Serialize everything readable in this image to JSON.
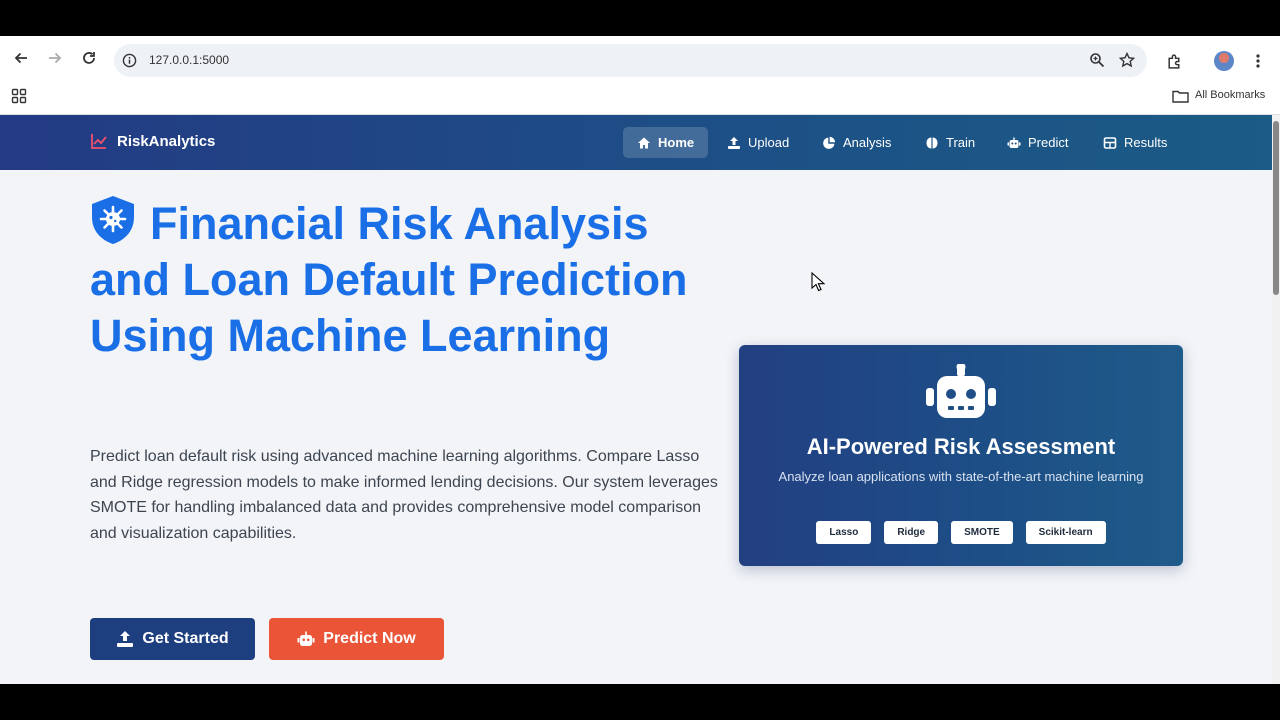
{
  "browser": {
    "url": "127.0.0.1:5000",
    "bookmarks_label": "All Bookmarks"
  },
  "navbar": {
    "brand": "RiskAnalytics",
    "items": [
      {
        "label": "Home",
        "icon": "home-icon",
        "active": true
      },
      {
        "label": "Upload",
        "icon": "upload-icon"
      },
      {
        "label": "Analysis",
        "icon": "pie-chart-icon"
      },
      {
        "label": "Train",
        "icon": "brain-icon"
      },
      {
        "label": "Predict",
        "icon": "robot-icon"
      },
      {
        "label": "Results",
        "icon": "table-icon"
      }
    ]
  },
  "hero": {
    "title": "Financial Risk Analysis and Loan Default Prediction Using Machine Learning",
    "description": "Predict loan default risk using advanced machine learning algorithms. Compare Lasso and Ridge regression models to make informed lending decisions. Our system leverages SMOTE for handling imbalanced data and provides comprehensive model comparison and visualization capabilities.",
    "primary_button": "Get Started",
    "secondary_button": "Predict Now"
  },
  "card": {
    "title": "AI-Powered Risk Assessment",
    "subtitle": "Analyze loan applications with state-of-the-art machine learning",
    "badges": [
      "Lasso",
      "Ridge",
      "SMOTE",
      "Scikit-learn"
    ]
  },
  "colors": {
    "primary": "#1a6fe6",
    "navbar": "#1d4f86",
    "accent": "#ea5538",
    "page_bg": "#f2f4f8"
  }
}
